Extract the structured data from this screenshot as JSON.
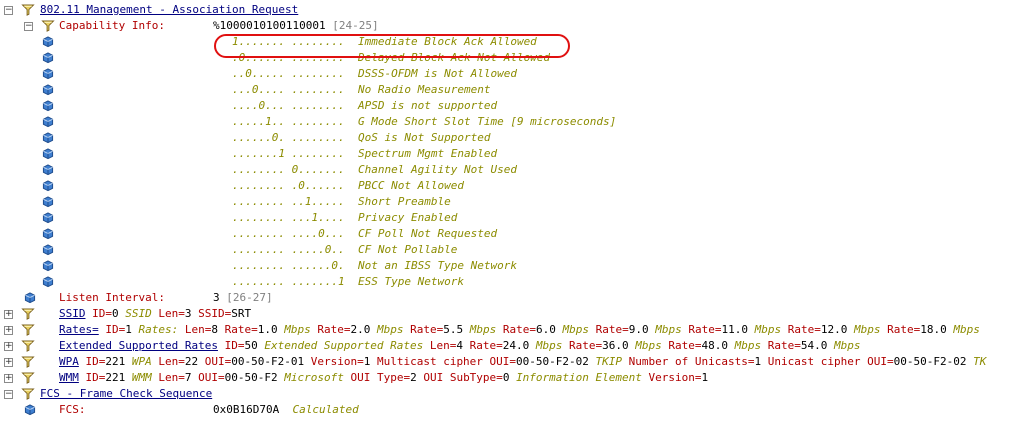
{
  "tree": {
    "mgmt": {
      "label": "802.11 Management - Association Request"
    },
    "capability": {
      "name": "Capability Info:",
      "value": "%1000010100110001",
      "range": "[24-25]",
      "bits": [
        {
          "bits": "1....... ........",
          "desc": "Immediate Block Ack Allowed"
        },
        {
          "bits": ".0...... ........",
          "desc": "Delayed Block Ack Not Allowed"
        },
        {
          "bits": "..0..... ........",
          "desc": "DSSS-OFDM is Not Allowed"
        },
        {
          "bits": "...0.... ........",
          "desc": "No Radio Measurement"
        },
        {
          "bits": "....0... ........",
          "desc": "APSD is not supported"
        },
        {
          "bits": ".....1.. ........",
          "desc": "G Mode Short Slot Time [9 microseconds]"
        },
        {
          "bits": "......0. ........",
          "desc": "QoS is Not Supported"
        },
        {
          "bits": ".......1 ........",
          "desc": "Spectrum Mgmt Enabled"
        },
        {
          "bits": "........ 0.......",
          "desc": "Channel Agility Not Used"
        },
        {
          "bits": "........ .0......",
          "desc": "PBCC Not Allowed"
        },
        {
          "bits": "........ ..1.....",
          "desc": "Short Preamble"
        },
        {
          "bits": "........ ...1....",
          "desc": "Privacy Enabled"
        },
        {
          "bits": "........ ....0...",
          "desc": "CF Poll Not Requested"
        },
        {
          "bits": "........ .....0..",
          "desc": "CF Not Pollable"
        },
        {
          "bits": "........ ......0.",
          "desc": "Not an IBSS Type Network"
        },
        {
          "bits": "........ .......1",
          "desc": "ESS Type Network"
        }
      ]
    },
    "listen": {
      "name": "Listen Interval:",
      "value": "3",
      "range": "[26-27]"
    },
    "ssid": {
      "link": "SSID",
      "p1k": "ID=",
      "p1v": "0",
      "p2": "SSID",
      "p3k": "Len=",
      "p3v": "3",
      "p4k": "SSID=",
      "p4v": "SRT"
    },
    "rates": {
      "link": "Rates=",
      "idk": "ID=",
      "idv": "1",
      "it": "Rates:",
      "lenk": "Len=",
      "lenv": "8",
      "items": [
        {
          "k": "Rate=",
          "v": "1.0",
          "u": "Mbps"
        },
        {
          "k": "Rate=",
          "v": "2.0",
          "u": "Mbps"
        },
        {
          "k": "Rate=",
          "v": "5.5",
          "u": "Mbps"
        },
        {
          "k": "Rate=",
          "v": "6.0",
          "u": "Mbps"
        },
        {
          "k": "Rate=",
          "v": "9.0",
          "u": "Mbps"
        },
        {
          "k": "Rate=",
          "v": "11.0",
          "u": "Mbps"
        },
        {
          "k": "Rate=",
          "v": "12.0",
          "u": "Mbps"
        },
        {
          "k": "Rate=",
          "v": "18.0",
          "u": "Mbps"
        }
      ]
    },
    "ext": {
      "link": "Extended Supported Rates",
      "idk": "ID=",
      "idv": "50",
      "it": "Extended Supported Rates",
      "lenk": "Len=",
      "lenv": "4",
      "items": [
        {
          "k": "Rate=",
          "v": "24.0",
          "u": "Mbps"
        },
        {
          "k": "Rate=",
          "v": "36.0",
          "u": "Mbps"
        },
        {
          "k": "Rate=",
          "v": "48.0",
          "u": "Mbps"
        },
        {
          "k": "Rate=",
          "v": "54.0",
          "u": "Mbps"
        }
      ]
    },
    "wpa": {
      "link": "WPA",
      "idk": "ID=",
      "idv": "221",
      "it": "WPA",
      "lenk": "Len=",
      "lenv": "22",
      "ouik": "OUI=",
      "ouiv": "00-50-F2-01",
      "verk": "Version=",
      "verv": "1",
      "mck": "Multicast cipher OUI=",
      "mcv": "00-50-F2-02",
      "mcit": "TKIP",
      "nuk": "Number of Unicasts=",
      "nuv": "1",
      "uck": "Unicast cipher OUI=",
      "ucv": "00-50-F2-02",
      "tail": "TK"
    },
    "wmm": {
      "link": "WMM",
      "idk": "ID=",
      "idv": "221",
      "it": "WMM",
      "lenk": "Len=",
      "lenv": "7",
      "ouik": "OUI=",
      "ouiv": "00-50-F2",
      "ouiit": "Microsoft",
      "typek": "OUI Type=",
      "typev": "2",
      "subk": "OUI SubType=",
      "subv": "0",
      "subit": "Information Element",
      "verk": "Version=",
      "verv": "1"
    },
    "fcs": {
      "label": "FCS - Frame Check Sequence",
      "name": "FCS:",
      "value": "0x0B16D70A",
      "status": "Calculated"
    }
  },
  "colors": {
    "link": "#000080",
    "field": "#b00000",
    "italic": "#8c8c00",
    "range": "#808080",
    "highlight": "#e01010"
  },
  "icons": {
    "expander": "minus-box",
    "folder": "filter-icon",
    "field": "cube-icon"
  }
}
